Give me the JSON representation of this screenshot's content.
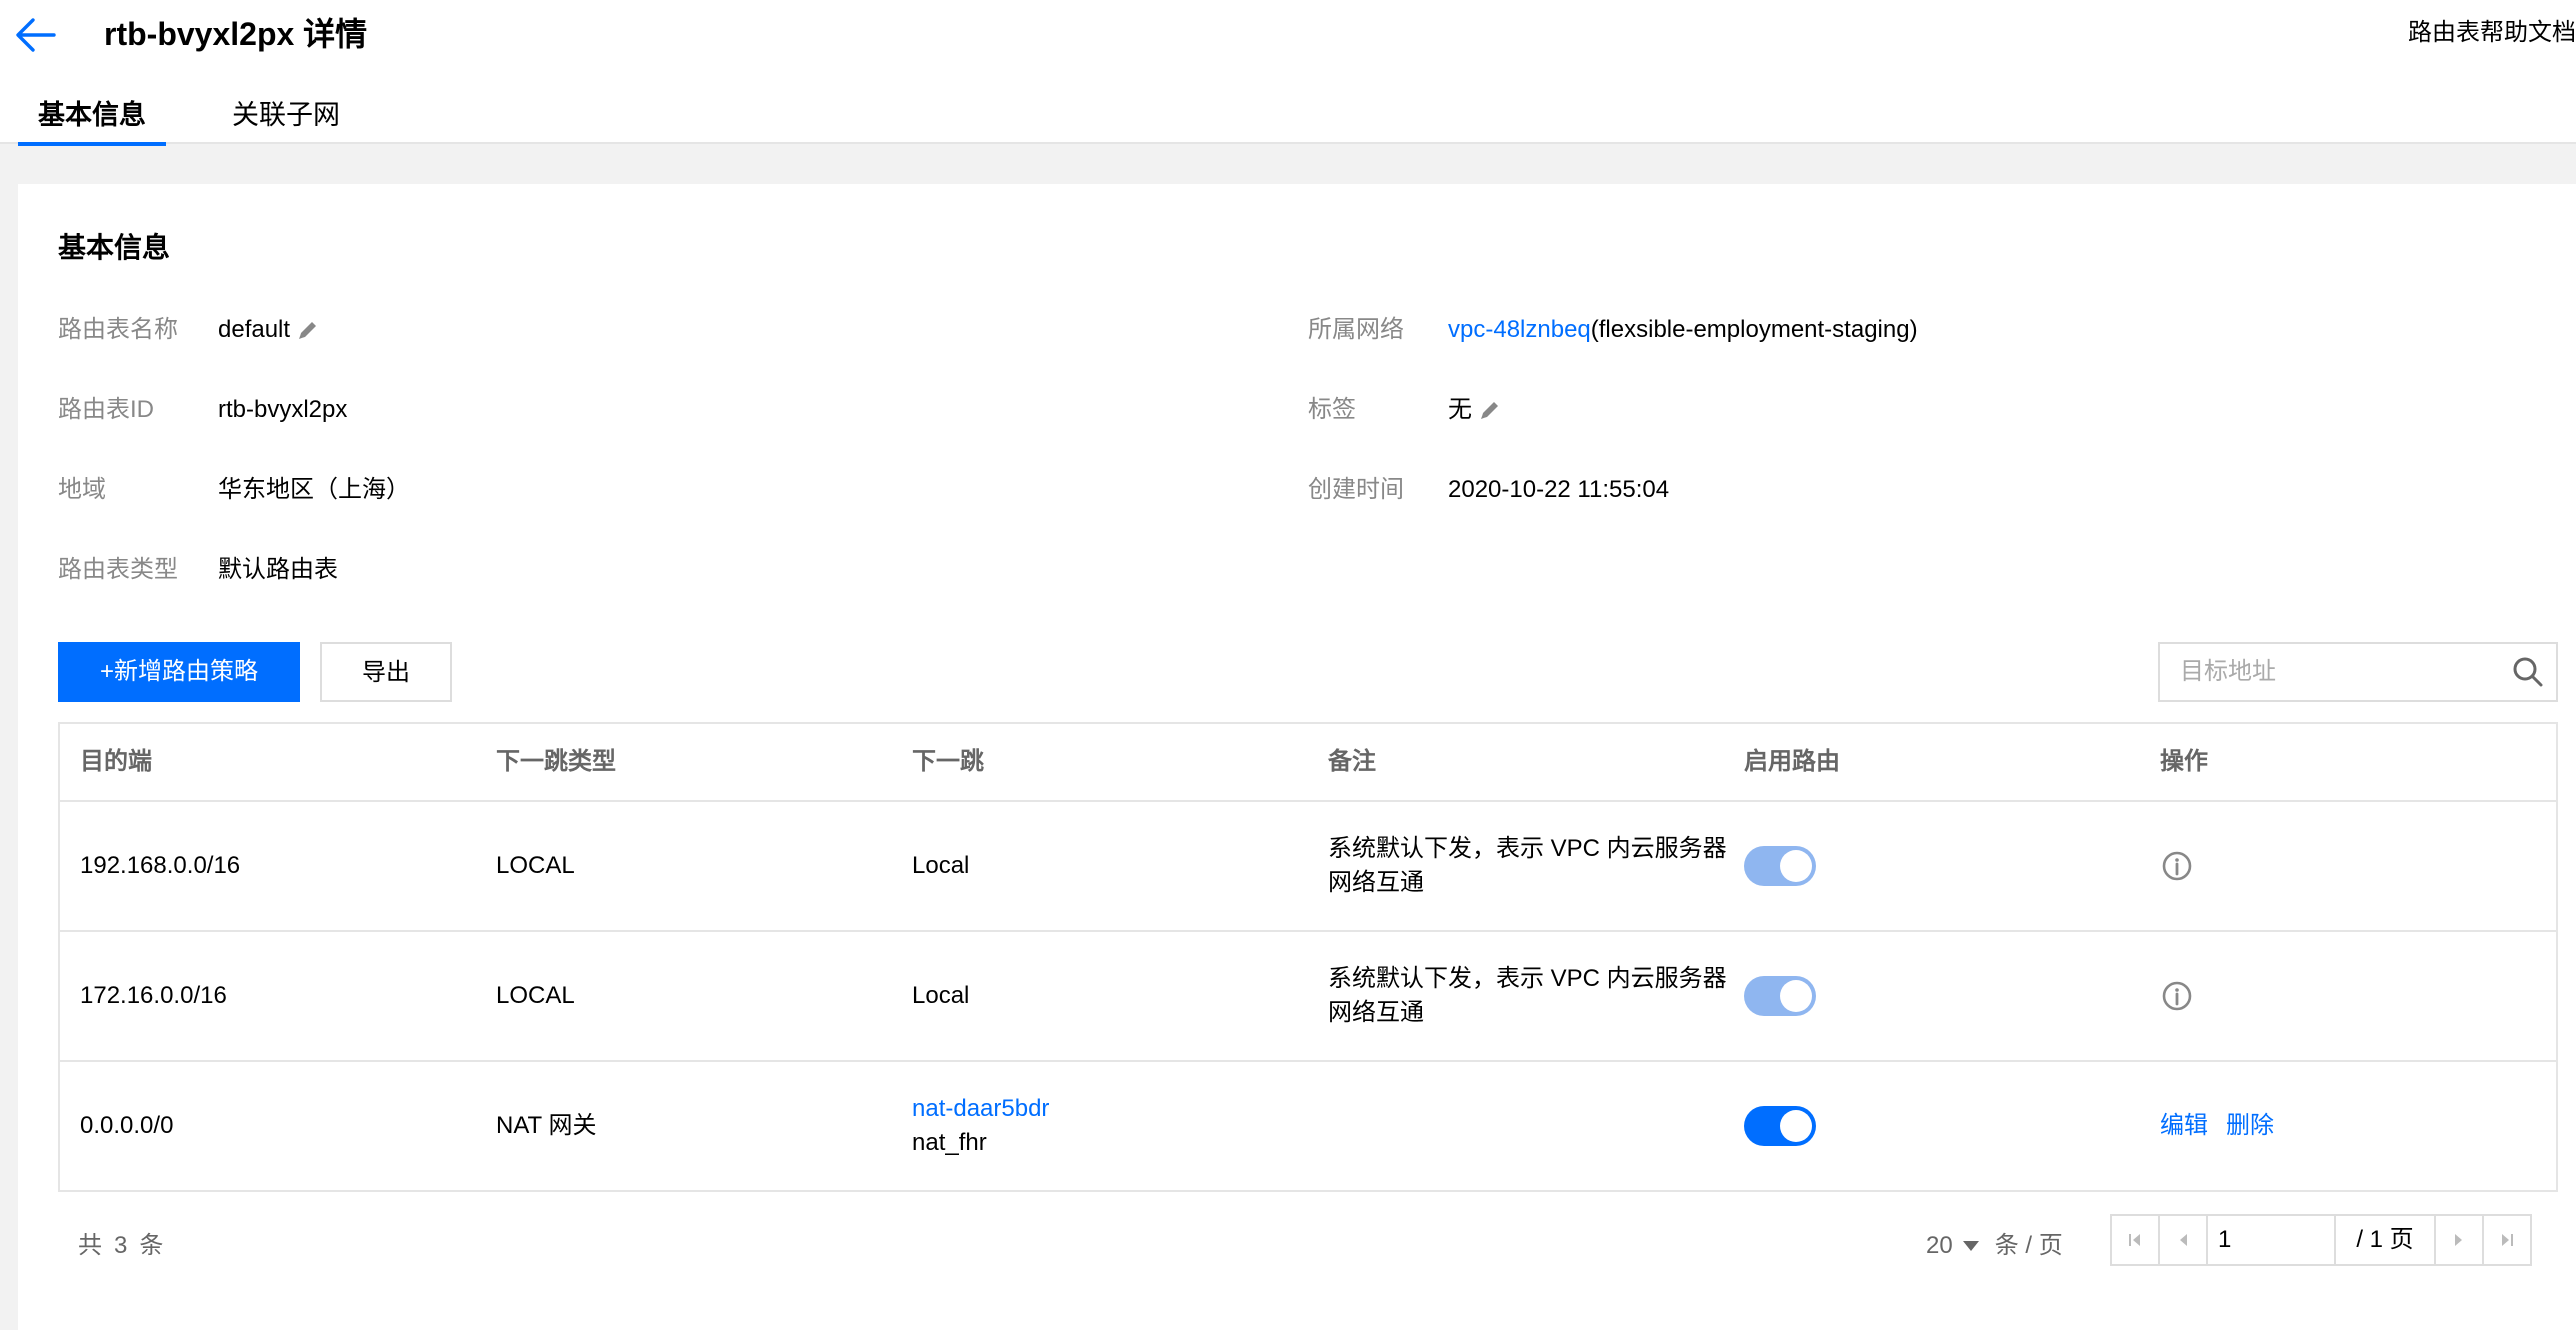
{
  "header": {
    "title": "rtb-bvyxl2px 详情",
    "help_link": "路由表帮助文档"
  },
  "tabs": [
    {
      "label": "基本信息",
      "active": true
    },
    {
      "label": "关联子网",
      "active": false
    }
  ],
  "basic_info": {
    "section_title": "基本信息",
    "fields": {
      "name": {
        "label": "路由表名称",
        "value": "default"
      },
      "id": {
        "label": "路由表ID",
        "value": "rtb-bvyxl2px"
      },
      "region": {
        "label": "地域",
        "value": "华东地区（上海）"
      },
      "type": {
        "label": "路由表类型",
        "value": "默认路由表"
      },
      "vpc": {
        "label": "所属网络",
        "link": "vpc-48lznbeq",
        "suffix": "(flexsible-employment-staging)"
      },
      "tags": {
        "label": "标签",
        "value": "无"
      },
      "created": {
        "label": "创建时间",
        "value": "2020-10-22 11:55:04"
      }
    }
  },
  "toolbar": {
    "add_label": "+新增路由策略",
    "export_label": "导出",
    "search_placeholder": "目标地址"
  },
  "table": {
    "columns": [
      "目的端",
      "下一跳类型",
      "下一跳",
      "备注",
      "启用路由",
      "操作"
    ],
    "rows": [
      {
        "dest": "192.168.0.0/16",
        "hop_type": "LOCAL",
        "hop": "Local",
        "hop_sub": "",
        "note": "系统默认下发，表示 VPC 内云服务器网络互通",
        "enabled": true,
        "editable": false
      },
      {
        "dest": "172.16.0.0/16",
        "hop_type": "LOCAL",
        "hop": "Local",
        "hop_sub": "",
        "note": "系统默认下发，表示 VPC 内云服务器网络互通",
        "enabled": true,
        "editable": false
      },
      {
        "dest": "0.0.0.0/0",
        "hop_type": "NAT 网关",
        "hop": "nat-daar5bdr",
        "hop_sub": "nat_fhr",
        "note": "",
        "enabled": true,
        "editable": true
      }
    ],
    "edit_label": "编辑",
    "delete_label": "删除"
  },
  "pagination": {
    "total_prefix": "共",
    "total_count": "3",
    "total_suffix": "条",
    "page_size": "20",
    "page_size_unit": "条 / 页",
    "current_page": "1",
    "total_pages": "/ 1 页"
  },
  "colors": {
    "primary": "#006eff",
    "toggle_disabled_on": "#8fb6f0",
    "toggle_on": "#006eff",
    "border": "#e5e5e5"
  }
}
